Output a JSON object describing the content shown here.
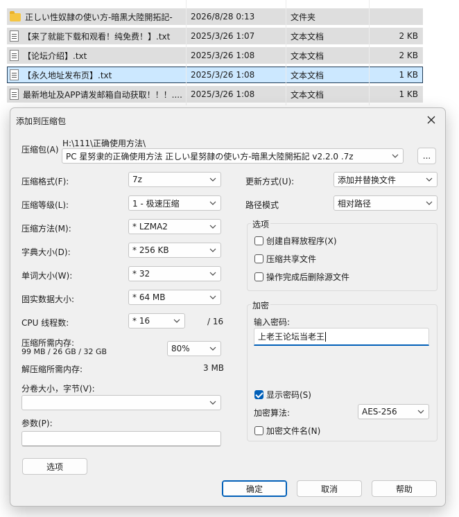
{
  "files": [
    {
      "name": "正しい性奴隷の使い方-暗黒大陸開拓記-",
      "date": "2026/8/28 0:13",
      "type": "文件夹",
      "size": "",
      "icon": "folder-icon",
      "selected": false
    },
    {
      "name": "【来了就能下载和观看！纯免费！】.txt",
      "date": "2025/3/26 1:07",
      "type": "文本文档",
      "size": "2 KB",
      "icon": "txt-file-icon",
      "selected": false
    },
    {
      "name": "【论坛介绍】.txt",
      "date": "2025/3/26 1:08",
      "type": "文本文档",
      "size": "2 KB",
      "icon": "txt-file-icon",
      "selected": false
    },
    {
      "name": "【永久地址发布页】.txt",
      "date": "2025/3/26 1:08",
      "type": "文本文档",
      "size": "1 KB",
      "icon": "txt-file-icon",
      "selected": true
    },
    {
      "name": "最新地址及APP请发邮箱自动获取！！！....",
      "date": "2025/3/26 1:08",
      "type": "文本文档",
      "size": "1 KB",
      "icon": "txt-file-icon",
      "selected": false
    }
  ],
  "dialog": {
    "title": "添加到压缩包",
    "archive_label": "压缩包(A)",
    "archive_path": "H:\\111\\正确使用方法\\",
    "archive_name": "PC 星努隶的正确使用方法 正しい星努隷の使い方-暗黒大陸開拓記 v2.2.0 .7z",
    "browse_label": "...",
    "format_label": "压缩格式(F):",
    "format_value": "7z",
    "level_label": "压缩等级(L):",
    "level_value": "1 - 极速压缩",
    "method_label": "压缩方法(M):",
    "method_value": "*  LZMA2",
    "dict_label": "字典大小(D):",
    "dict_value": "*  256 KB",
    "word_label": "单词大小(W):",
    "word_value": "*  32",
    "solid_label": "固实数据大小:",
    "solid_value": "*  64 MB",
    "cpu_label": "CPU 线程数:",
    "cpu_value": "*  16",
    "cpu_max": "/ 16",
    "mem_label": "压缩所需内存:",
    "mem_values": "99 MB / 26 GB / 32 GB",
    "mem_percent": "80%",
    "decomp_label": "解压缩所需内存:",
    "decomp_value": "3 MB",
    "split_label": "分卷大小，字节(V):",
    "split_value": "",
    "params_label": "参数(P):",
    "params_value": "",
    "options_button": "选项",
    "update_label": "更新方式(U):",
    "update_value": "添加并替换文件",
    "path_mode_label": "路径模式",
    "path_mode_value": "相对路径",
    "options_group": "选项",
    "opt_sfx": "创建自释放程序(X)",
    "opt_shared": "压缩共享文件",
    "opt_delete": "操作完成后删除源文件",
    "encrypt_group": "加密",
    "password_label": "输入密码:",
    "password_value": "上老王论坛当老王",
    "show_password": "显示密码(S)",
    "enc_method_label": "加密算法:",
    "enc_method_value": "AES-256",
    "encrypt_names": "加密文件名(N)",
    "ok": "确定",
    "cancel": "取消",
    "help": "帮助"
  },
  "colors": {
    "accent": "#005fb8",
    "selected_row": "#cce8ff",
    "folder": "#f5c542"
  }
}
